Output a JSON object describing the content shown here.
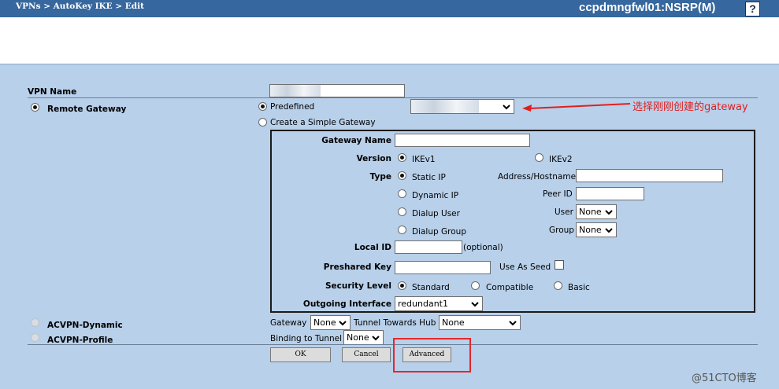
{
  "header": {
    "breadcrumb": "VPNs > AutoKey IKE > Edit",
    "device_title": "ccpdmngfwl01:NSRP(M)",
    "help_label": "?"
  },
  "form": {
    "vpn_name_label": "VPN Name",
    "remote_gateway_label": "Remote Gateway",
    "predefined_label": "Predefined",
    "create_simple_gateway_label": "Create a Simple Gateway",
    "gateway_name_label": "Gateway Name",
    "version_label": "Version",
    "ikev1_label": "IKEv1",
    "ikev2_label": "IKEv2",
    "type_label": "Type",
    "static_ip_label": "Static IP",
    "dynamic_ip_label": "Dynamic IP",
    "dialup_user_label": "Dialup User",
    "dialup_group_label": "Dialup Group",
    "address_hostname_label": "Address/Hostname",
    "peer_id_label": "Peer ID",
    "user_label": "User",
    "user_value": "None",
    "group_label": "Group",
    "group_value": "None",
    "local_id_label": "Local ID",
    "optional_hint": "(optional)",
    "preshared_key_label": "Preshared Key",
    "use_as_seed_label": "Use As Seed",
    "security_level_label": "Security Level",
    "standard_label": "Standard",
    "compatible_label": "Compatible",
    "basic_label": "Basic",
    "outgoing_interface_label": "Outgoing Interface",
    "outgoing_interface_value": "redundant1",
    "acvpn_dynamic_label": "ACVPN-Dynamic",
    "acvpn_profile_label": "ACVPN-Profile",
    "gateway_label": "Gateway",
    "gateway_value": "None",
    "tunnel_towards_hub_label": "Tunnel Towards Hub",
    "tunnel_towards_hub_value": "None",
    "binding_to_tunnel_label": "Binding to Tunnel",
    "binding_to_tunnel_value": "None"
  },
  "buttons": {
    "ok": "OK",
    "cancel": "Cancel",
    "advanced": "Advanced"
  },
  "annotation": {
    "note": "选择刚刚创建的gateway"
  },
  "watermark": "@51CTO博客",
  "colors": {
    "header_bar": "#36679e",
    "page_bg": "#b8d0ea",
    "annotation": "#e02020",
    "highlight_box": "#e2282c"
  }
}
